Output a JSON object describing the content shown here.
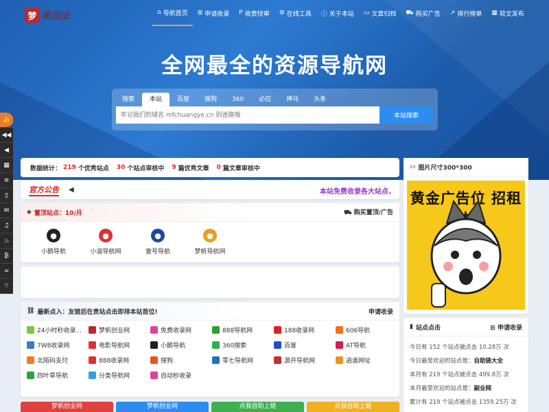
{
  "logo": {
    "mark": "梦",
    "text": "帆创业"
  },
  "nav": [
    {
      "icon": "home-icon",
      "glyph": "⌂",
      "label": "导航首页"
    },
    {
      "icon": "plus-square-icon",
      "glyph": "⊞",
      "label": "申请收录"
    },
    {
      "icon": "paypal-icon",
      "glyph": "P",
      "label": "收费快审"
    },
    {
      "icon": "cogs-icon",
      "glyph": "⚙",
      "label": "在线工具"
    },
    {
      "icon": "info-icon",
      "glyph": "ⓘ",
      "label": "关于本站"
    },
    {
      "icon": "folder-icon",
      "glyph": "▭",
      "label": "文章归档"
    },
    {
      "icon": "cart-icon",
      "glyph": "⛟",
      "label": "购买广告"
    },
    {
      "icon": "chart-icon",
      "glyph": "↗",
      "label": "排行榜单"
    },
    {
      "icon": "grid-icon",
      "glyph": "▦",
      "label": "软文发布"
    }
  ],
  "hero": {
    "title": "全网最全的资源导航网"
  },
  "search": {
    "tabs": [
      "搜索",
      "本站",
      "百度",
      "搜狗",
      "360",
      "必应",
      "神马",
      "头条"
    ],
    "placeholder": "牢记我们的域名 mfchuangye.cn 别迷路哦",
    "button": "本站搜索"
  },
  "stats": {
    "label": "数据统计：",
    "sites": "219",
    "sites_label": "个优秀站点",
    "pending": "30",
    "pending_label": "个站点审核中",
    "articles": "9",
    "articles_label": "篇优秀文章",
    "pending_articles": "0",
    "pending_articles_label": "篇文章审核中"
  },
  "notice": {
    "badge": "官方公告",
    "text": "本站免费收录各大站点，"
  },
  "pinned": {
    "title": "置顶站点：10/月",
    "right": "购买置顶/广告",
    "items": [
      {
        "label": "小鹅导航",
        "color": "#222"
      },
      {
        "label": "小滋导航网",
        "color": "#e03030"
      },
      {
        "label": "壹号导航",
        "color": "#1a4aa0"
      },
      {
        "label": "梦帆导航网",
        "color": "#e8a020"
      }
    ]
  },
  "recent": {
    "title": "最新点入：友链后在贵站点击即排本站首位!",
    "right": "申请收录",
    "links": [
      {
        "label": "24小时秒收录...",
        "color": "#7ac943"
      },
      {
        "label": "梦帆创业网",
        "color": "#c0262c"
      },
      {
        "label": "免费收录网",
        "color": "#e040a0"
      },
      {
        "label": "888导航网",
        "color": "#2ca02c"
      },
      {
        "label": "188收录网",
        "color": "#e02020"
      },
      {
        "label": "606导航",
        "color": "#f07020"
      },
      {
        "label": "7W8收录网",
        "color": "#3a7ad0"
      },
      {
        "label": "电影导航网",
        "color": "#e03030"
      },
      {
        "label": "小鹅导航",
        "color": "#222"
      },
      {
        "label": "360搜索",
        "color": "#2cb050"
      },
      {
        "label": "百度",
        "color": "#2050c0"
      },
      {
        "label": "AT导航",
        "color": "#d02050"
      },
      {
        "label": "北陌码支付",
        "color": "#f07a20"
      },
      {
        "label": "888收录网",
        "color": "#e03030"
      },
      {
        "label": "搜狗",
        "color": "#f05020"
      },
      {
        "label": "零七导航网",
        "color": "#2070c0"
      },
      {
        "label": "源开导航网",
        "color": "#c03030"
      },
      {
        "label": "逍遥网址",
        "color": "#f09020"
      },
      {
        "label": "四叶草导航",
        "color": "#30a040"
      },
      {
        "label": "分类导航网",
        "color": "#30a0e0"
      },
      {
        "label": "自动秒收录",
        "color": "#e040a0"
      }
    ]
  },
  "bottom_buttons": [
    {
      "label": "梦帆创业网",
      "color": "#e04040"
    },
    {
      "label": "梦帆创业网",
      "color": "#2d8cf0"
    },
    {
      "label": "点我自助上链",
      "color": "#3cb050"
    },
    {
      "label": "点我自助上链",
      "color": "#f0b020"
    }
  ],
  "ad": {
    "title": "图片尺寸300*300",
    "text": "黄金广告位 招租中"
  },
  "site_stats": {
    "title": "站点点击",
    "right": "申请收录",
    "rows": [
      {
        "text": "今日有 152 个站点被点击 10.28万 次"
      },
      {
        "text": "今日最受欢迎的站点是：",
        "bold": "自助链大全"
      },
      {
        "text": "本月有 219 个站点被点击 499.8万 次"
      },
      {
        "text": "本月最受欢迎的站点是：",
        "bold": "副业网"
      },
      {
        "text": "累计有 219 个站点被点击 1359.25万 次"
      }
    ]
  },
  "float_bar": [
    "thumbs-up-icon",
    "backward-icon",
    "bullhorn-icon",
    "calendar-icon",
    "list-icon",
    "mobile-icon",
    "weixin-icon",
    "qq-icon",
    "fire-icon",
    "bitcoin-icon",
    "binoculars-icon",
    "wifi-icon"
  ]
}
